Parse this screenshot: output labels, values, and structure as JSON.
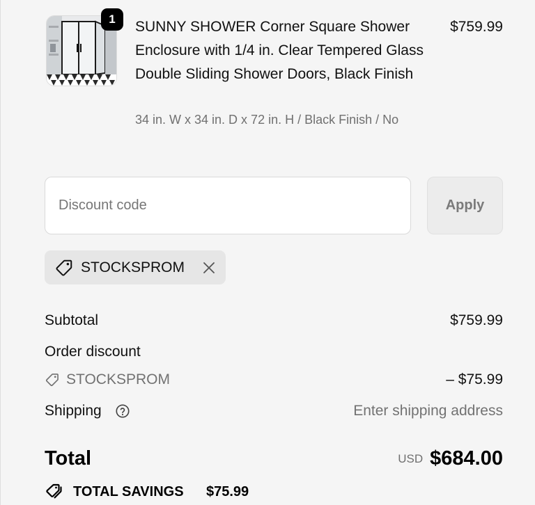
{
  "product": {
    "quantity": "1",
    "title": "SUNNY SHOWER Corner Square Shower Enclosure with 1/4 in. Clear Tempered Glass Double Sliding Shower Doors, Black Finish",
    "variant": "34 in. W x 34 in. D x 72 in. H / Black Finish / No",
    "price": "$759.99"
  },
  "discount": {
    "placeholder": "Discount code",
    "value": "",
    "apply_label": "Apply",
    "applied_code": "STOCKSPROM"
  },
  "summary": {
    "subtotal_label": "Subtotal",
    "subtotal_value": "$759.99",
    "order_discount_label": "Order discount",
    "order_discount_code": "STOCKSPROM",
    "order_discount_value": "– $75.99",
    "shipping_label": "Shipping",
    "shipping_value": "Enter shipping address",
    "total_label": "Total",
    "currency": "USD",
    "total_value": "$684.00",
    "savings_label": "TOTAL SAVINGS",
    "savings_value": "$75.99"
  },
  "icons": {
    "tag": "tag-icon",
    "remove": "close-icon",
    "help": "question-circle-icon",
    "savings": "tags-icon"
  },
  "colors": {
    "background": "#f5f5f5",
    "muted_text": "#727272",
    "badge": "#000000",
    "chip": "#e6e6e6",
    "apply_button": "#ececec"
  }
}
